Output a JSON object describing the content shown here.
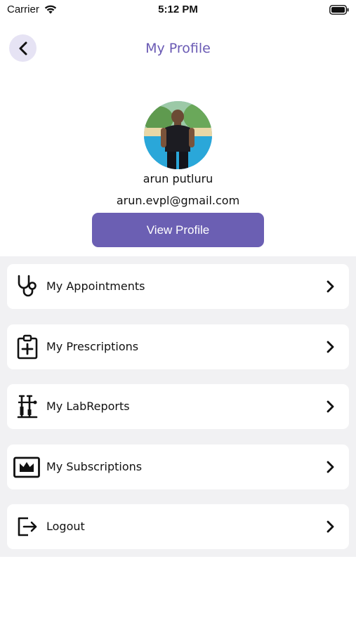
{
  "status_bar": {
    "carrier": "Carrier",
    "time": "5:12 PM"
  },
  "header": {
    "title": "My Profile"
  },
  "profile": {
    "name": "arun putluru",
    "email": "arun.evpl@gmail.com",
    "view_profile_label": "View Profile"
  },
  "menu": {
    "items": [
      {
        "label": "My Appointments",
        "icon": "stethoscope-icon"
      },
      {
        "label": "My Prescriptions",
        "icon": "clipboard-plus-icon"
      },
      {
        "label": "My LabReports",
        "icon": "test-tubes-icon"
      },
      {
        "label": "My Subscriptions",
        "icon": "crown-card-icon"
      },
      {
        "label": "Logout",
        "icon": "logout-icon"
      }
    ]
  },
  "colors": {
    "accent": "#6b5fb3",
    "title": "#6a5ab4",
    "back_bg": "#e6e3f4",
    "menu_bg": "#f1f1f3"
  }
}
